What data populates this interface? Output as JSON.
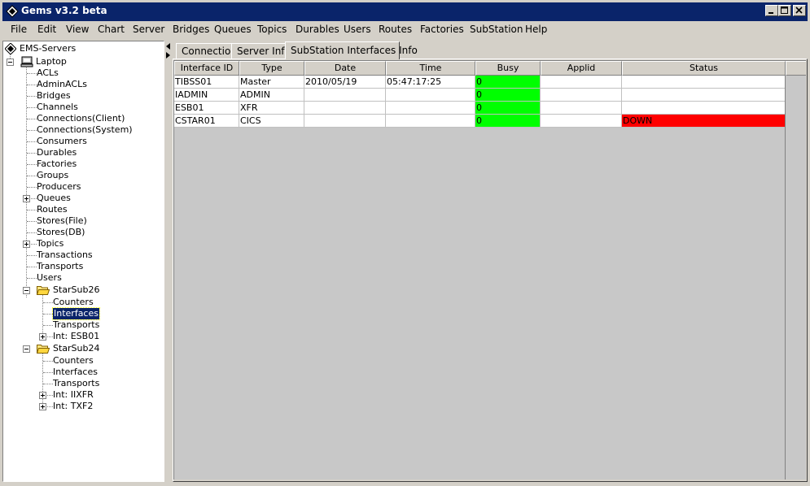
{
  "window": {
    "title": "Gems v3.2 beta",
    "title_bar_color": "#0a246a",
    "controls": [
      "minimize-icon",
      "maximize-icon",
      "close-icon"
    ]
  },
  "menu": {
    "items": [
      {
        "label": "File"
      },
      {
        "label": "Edit"
      },
      {
        "label": "View"
      },
      {
        "label": "Chart"
      },
      {
        "label": "Server"
      },
      {
        "label": "Bridges"
      },
      {
        "label": "Queues"
      },
      {
        "label": "Topics"
      },
      {
        "label": "Durables"
      },
      {
        "label": "Users"
      },
      {
        "label": "Routes"
      },
      {
        "label": "Factories"
      },
      {
        "label": "SubStation"
      },
      {
        "label": "Help"
      }
    ]
  },
  "tree": {
    "root": "EMS-Servers",
    "server": "Laptop",
    "nodes": [
      "ACLs",
      "AdminACLs",
      "Bridges",
      "Channels",
      "Connections(Client)",
      "Connections(System)",
      "Consumers",
      "Durables",
      "Factories",
      "Groups",
      "Producers",
      "Queues",
      "Routes",
      "Stores(File)",
      "Stores(DB)",
      "Topics",
      "Transactions",
      "Transports",
      "Users"
    ],
    "substation1": {
      "label": "StarSub26",
      "children": [
        "Counters",
        "Interfaces",
        "Transports",
        "Int: ESB01"
      ]
    },
    "substation2": {
      "label": "StarSub24",
      "children": [
        "Counters",
        "Interfaces",
        "Transports",
        "Int: IIXFR",
        "Int: TXF2"
      ]
    },
    "selected": "Interfaces"
  },
  "tabs": [
    {
      "label": "Connection"
    },
    {
      "label": "Server Info"
    },
    {
      "label": "SubStation Interfaces Info"
    }
  ],
  "table": {
    "columns": [
      "Interface ID",
      "Type",
      "Date",
      "Time",
      "Busy",
      "Applid",
      "Status"
    ],
    "rows": [
      {
        "interface_id": "TIBSS01",
        "type": "Master",
        "date": "2010/05/19",
        "time": "05:47:17:25",
        "busy": "0",
        "applid": "",
        "status": ""
      },
      {
        "interface_id": "IADMIN",
        "type": "ADMIN",
        "date": "",
        "time": "",
        "busy": "0",
        "applid": "",
        "status": ""
      },
      {
        "interface_id": "ESB01",
        "type": "XFR",
        "date": "",
        "time": "",
        "busy": "0",
        "applid": "",
        "status": ""
      },
      {
        "interface_id": "CSTAR01",
        "type": "CICS",
        "date": "",
        "time": "",
        "busy": "0",
        "applid": "",
        "status": "DOWN"
      }
    ],
    "busy_color": "#00ff00",
    "down_color": "#ff0000"
  }
}
